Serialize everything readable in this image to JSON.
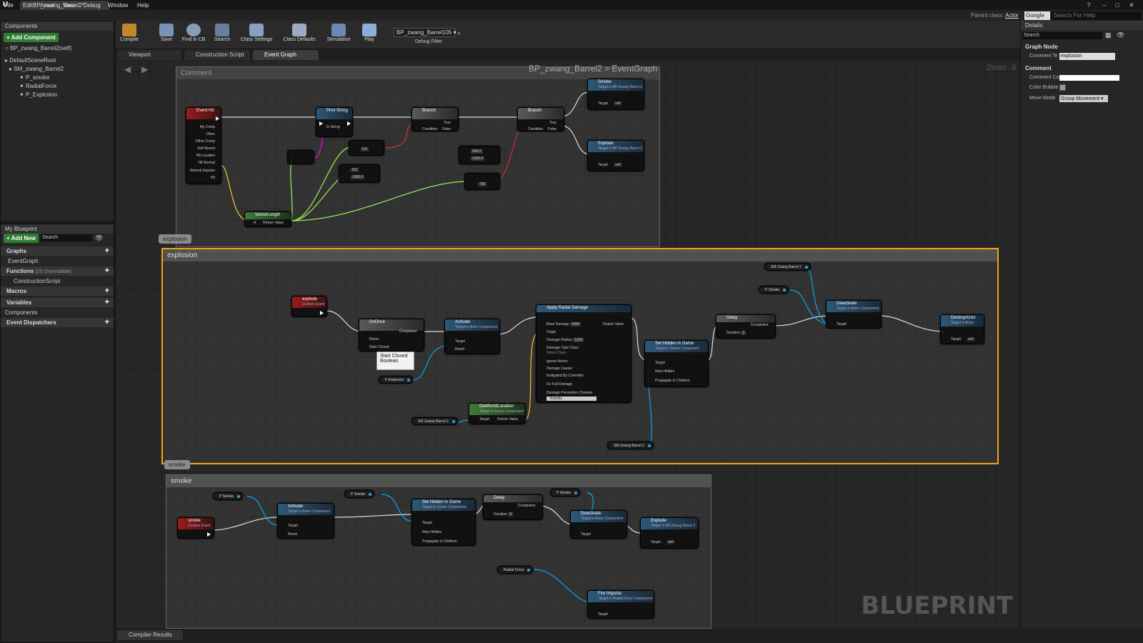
{
  "window": {
    "doc_tab": "BP_zwang_Barrel2*"
  },
  "menu": [
    "File",
    "Edit",
    "Asset",
    "View",
    "Debug",
    "Window",
    "Help"
  ],
  "header": {
    "parent_class_label": "Parent class:",
    "parent_class_value": "Actor",
    "search_engine": "Google",
    "search_placeholder": "Search For Help"
  },
  "components_panel": {
    "title": "Components",
    "add_button": "+ Add Component",
    "self_item": "BP_zwang_Barrel2(self)",
    "tree": [
      "DefaultSceneRoot",
      "SM_zwang_Barrel2",
      "P_smoke",
      "RadialForce",
      "P_Explosion"
    ]
  },
  "my_blueprint": {
    "title": "My Blueprint",
    "add_new": "+ Add New",
    "search_placeholder": "Search",
    "graphs_label": "Graphs",
    "graph_item": "EventGraph",
    "functions_label": "Functions",
    "functions_count": "(20 Overridable)",
    "function_item": "ConstructionScript",
    "macros_label": "Macros",
    "variables_label": "Variables",
    "components_label": "Components",
    "dispatchers_label": "Event Dispatchers"
  },
  "toolbar": {
    "compile": "Compile",
    "save": "Save",
    "find_in_cb": "Find in CB",
    "search": "Search",
    "class_settings": "Class Settings",
    "class_defaults": "Class Defaults",
    "simulation": "Simulation",
    "play": "Play",
    "debug_object": "BP_zwang_Barrel105",
    "debug_filter": "Debug Filter"
  },
  "editor_tabs": [
    "Viewport",
    "Construction Script",
    "Event Graph"
  ],
  "graph": {
    "breadcrumb": "BP_zwang_Barrel2 > EventGraph",
    "zoom": "Zoom -3",
    "watermark": "BLUEPRINT",
    "top_comment": "Comment",
    "explosion_bubble": "explosion",
    "explosion_title": "explosion",
    "smoke_bubble": "smoke",
    "smoke_title": "smoke",
    "tooltip": [
      "Start Closed",
      "Boolean"
    ]
  },
  "nodes": {
    "event_hit": {
      "title": "Event Hit",
      "pins": [
        "My Comp",
        "Other",
        "Other Comp",
        "Self Moved",
        "Hit Location",
        "Hit Normal",
        "Normal Impulse",
        "Hit"
      ]
    },
    "print_string": {
      "title": "Print String",
      "pin": "In String"
    },
    "branch1": {
      "title": "Branch",
      "true": "True",
      "false": "False",
      "cond": "Condition"
    },
    "branch2": {
      "title": "Branch",
      "true": "True",
      "false": "False",
      "cond": "Condition"
    },
    "smoke_call": {
      "title": "Smoke",
      "sub": "Target is BP Zwang Barrel 2",
      "target": "Target",
      "self": "self"
    },
    "explode_call": {
      "title": "Explode",
      "sub": "Target is BP Zwang Barrel 2",
      "target": "Target",
      "self": "self"
    },
    "vector_length": {
      "title": "VectorLength",
      "a": "A",
      "rv": "Return Value"
    },
    "compare_vals": [
      "0.0",
      "500.0",
      "0.0",
      "1000.0",
      "1000.0",
      "700"
    ],
    "explode_event": {
      "title": "explode",
      "sub": "Custom Event"
    },
    "do_once": {
      "title": "DoOnce",
      "completed": "Completed",
      "reset": "Reset",
      "start_closed": "Start Closed"
    },
    "activate1": {
      "title": "Activate",
      "sub": "Target is Actor Component",
      "target": "Target",
      "reset": "Reset"
    },
    "p_explosion_var": "P Explosion",
    "sm_var1": "SM Zwang Barrel 2",
    "sm_var2": "SM Zwang Barrel 2",
    "sm_var3": "SM Zwang Barrel 2",
    "get_world_location": {
      "title": "GetWorldLocation",
      "sub": "Target is Scene Component",
      "target": "Target",
      "rv": "Return Value"
    },
    "apply_radial_damage": {
      "title": "Apply Radial Damage",
      "pins": [
        "Base Damage",
        "Origin",
        "Damage Radius",
        "Damage Type Class",
        "Ignore Actors",
        "Damage Causer",
        "Instigated By Controller",
        "Do Full Damage",
        "Damage Prevention Channel"
      ],
      "base_damage": "3000",
      "radius": "1000",
      "class_sel": "Select Class",
      "channel": "Visibility",
      "rv": "Return Value"
    },
    "set_hidden1": {
      "title": "Set Hidden in Game",
      "sub": "Target is Scene Component",
      "target": "Target",
      "new_hidden": "New Hidden",
      "propagate": "Propagate to Children"
    },
    "delay1": {
      "title": "Delay",
      "duration": "Duration",
      "dur_val": "3",
      "completed": "Completed"
    },
    "p_smoke_var1": "P Smoke",
    "deactivate1": {
      "title": "Deactivate",
      "sub": "Target is Actor Component",
      "target": "Target"
    },
    "destroy_actor": {
      "title": "DestroyActor",
      "sub": "Target is Actor",
      "target": "Target",
      "self": "self"
    },
    "smoke_event": {
      "title": "smoke",
      "sub": "Custom Event"
    },
    "p_smoke_var2": "P Smoke",
    "activate2": {
      "title": "Activate",
      "sub": "Target is Actor Component",
      "target": "Target",
      "reset": "Reset"
    },
    "p_smoke_var3": "P Smoke",
    "set_hidden2": {
      "title": "Set Hidden in Game",
      "sub": "Target is Scene Component",
      "target": "Target",
      "new_hidden": "New Hidden",
      "propagate": "Propagate to Children"
    },
    "delay2": {
      "title": "Delay",
      "duration": "Duration",
      "dur_val": "3",
      "completed": "Completed"
    },
    "p_smoke_var4": "P Smoke",
    "deactivate2": {
      "title": "Deactivate",
      "sub": "Target is Actor Component",
      "target": "Target"
    },
    "explode_call2": {
      "title": "Explode",
      "sub": "Target is BP Zwang Barrel 2",
      "target": "Target",
      "self": "self"
    },
    "radial_force_var": "Radial Force",
    "fire_impulse": {
      "title": "Fire Impulse",
      "sub": "Target is Radial Force Component",
      "target": "Target"
    }
  },
  "details": {
    "title": "Details",
    "search_placeholder": "Search",
    "graph_node_section": "Graph Node",
    "comment_text_label": "Comment Te",
    "comment_text_value": "explosion",
    "comment_section": "Comment",
    "comment_color_label": "Comment Co",
    "color_bubble_label": "Color Bubble",
    "move_mode_label": "Move Mode",
    "move_mode_value": "Group Movement"
  },
  "bottom": {
    "compiler_results": "Compiler Results"
  },
  "colors": {
    "exec": "#ffffff",
    "float": "#9cf550",
    "bool": "#8c0000",
    "object": "#0aa5f0",
    "string": "#f00cd6",
    "vector": "#f0c53c",
    "explosion_frame": "#f2a51a"
  }
}
